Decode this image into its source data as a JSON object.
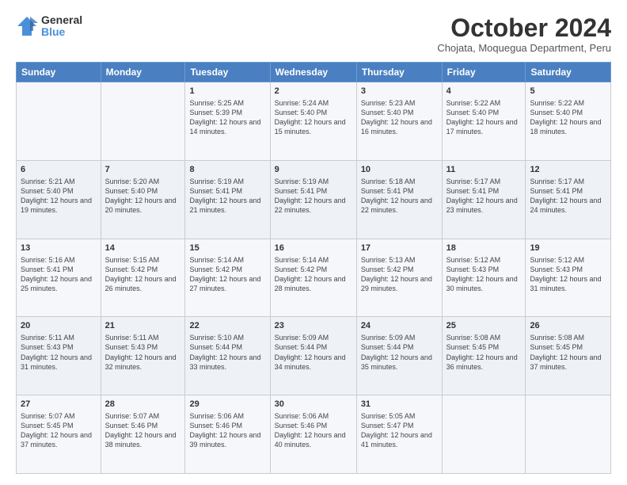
{
  "logo": {
    "general": "General",
    "blue": "Blue"
  },
  "header": {
    "month": "October 2024",
    "location": "Chojata, Moquegua Department, Peru"
  },
  "weekdays": [
    "Sunday",
    "Monday",
    "Tuesday",
    "Wednesday",
    "Thursday",
    "Friday",
    "Saturday"
  ],
  "weeks": [
    [
      {
        "day": "",
        "info": ""
      },
      {
        "day": "",
        "info": ""
      },
      {
        "day": "1",
        "info": "Sunrise: 5:25 AM\nSunset: 5:39 PM\nDaylight: 12 hours and 14 minutes."
      },
      {
        "day": "2",
        "info": "Sunrise: 5:24 AM\nSunset: 5:40 PM\nDaylight: 12 hours and 15 minutes."
      },
      {
        "day": "3",
        "info": "Sunrise: 5:23 AM\nSunset: 5:40 PM\nDaylight: 12 hours and 16 minutes."
      },
      {
        "day": "4",
        "info": "Sunrise: 5:22 AM\nSunset: 5:40 PM\nDaylight: 12 hours and 17 minutes."
      },
      {
        "day": "5",
        "info": "Sunrise: 5:22 AM\nSunset: 5:40 PM\nDaylight: 12 hours and 18 minutes."
      }
    ],
    [
      {
        "day": "6",
        "info": "Sunrise: 5:21 AM\nSunset: 5:40 PM\nDaylight: 12 hours and 19 minutes."
      },
      {
        "day": "7",
        "info": "Sunrise: 5:20 AM\nSunset: 5:40 PM\nDaylight: 12 hours and 20 minutes."
      },
      {
        "day": "8",
        "info": "Sunrise: 5:19 AM\nSunset: 5:41 PM\nDaylight: 12 hours and 21 minutes."
      },
      {
        "day": "9",
        "info": "Sunrise: 5:19 AM\nSunset: 5:41 PM\nDaylight: 12 hours and 22 minutes."
      },
      {
        "day": "10",
        "info": "Sunrise: 5:18 AM\nSunset: 5:41 PM\nDaylight: 12 hours and 22 minutes."
      },
      {
        "day": "11",
        "info": "Sunrise: 5:17 AM\nSunset: 5:41 PM\nDaylight: 12 hours and 23 minutes."
      },
      {
        "day": "12",
        "info": "Sunrise: 5:17 AM\nSunset: 5:41 PM\nDaylight: 12 hours and 24 minutes."
      }
    ],
    [
      {
        "day": "13",
        "info": "Sunrise: 5:16 AM\nSunset: 5:41 PM\nDaylight: 12 hours and 25 minutes."
      },
      {
        "day": "14",
        "info": "Sunrise: 5:15 AM\nSunset: 5:42 PM\nDaylight: 12 hours and 26 minutes."
      },
      {
        "day": "15",
        "info": "Sunrise: 5:14 AM\nSunset: 5:42 PM\nDaylight: 12 hours and 27 minutes."
      },
      {
        "day": "16",
        "info": "Sunrise: 5:14 AM\nSunset: 5:42 PM\nDaylight: 12 hours and 28 minutes."
      },
      {
        "day": "17",
        "info": "Sunrise: 5:13 AM\nSunset: 5:42 PM\nDaylight: 12 hours and 29 minutes."
      },
      {
        "day": "18",
        "info": "Sunrise: 5:12 AM\nSunset: 5:43 PM\nDaylight: 12 hours and 30 minutes."
      },
      {
        "day": "19",
        "info": "Sunrise: 5:12 AM\nSunset: 5:43 PM\nDaylight: 12 hours and 31 minutes."
      }
    ],
    [
      {
        "day": "20",
        "info": "Sunrise: 5:11 AM\nSunset: 5:43 PM\nDaylight: 12 hours and 31 minutes."
      },
      {
        "day": "21",
        "info": "Sunrise: 5:11 AM\nSunset: 5:43 PM\nDaylight: 12 hours and 32 minutes."
      },
      {
        "day": "22",
        "info": "Sunrise: 5:10 AM\nSunset: 5:44 PM\nDaylight: 12 hours and 33 minutes."
      },
      {
        "day": "23",
        "info": "Sunrise: 5:09 AM\nSunset: 5:44 PM\nDaylight: 12 hours and 34 minutes."
      },
      {
        "day": "24",
        "info": "Sunrise: 5:09 AM\nSunset: 5:44 PM\nDaylight: 12 hours and 35 minutes."
      },
      {
        "day": "25",
        "info": "Sunrise: 5:08 AM\nSunset: 5:45 PM\nDaylight: 12 hours and 36 minutes."
      },
      {
        "day": "26",
        "info": "Sunrise: 5:08 AM\nSunset: 5:45 PM\nDaylight: 12 hours and 37 minutes."
      }
    ],
    [
      {
        "day": "27",
        "info": "Sunrise: 5:07 AM\nSunset: 5:45 PM\nDaylight: 12 hours and 37 minutes."
      },
      {
        "day": "28",
        "info": "Sunrise: 5:07 AM\nSunset: 5:46 PM\nDaylight: 12 hours and 38 minutes."
      },
      {
        "day": "29",
        "info": "Sunrise: 5:06 AM\nSunset: 5:46 PM\nDaylight: 12 hours and 39 minutes."
      },
      {
        "day": "30",
        "info": "Sunrise: 5:06 AM\nSunset: 5:46 PM\nDaylight: 12 hours and 40 minutes."
      },
      {
        "day": "31",
        "info": "Sunrise: 5:05 AM\nSunset: 5:47 PM\nDaylight: 12 hours and 41 minutes."
      },
      {
        "day": "",
        "info": ""
      },
      {
        "day": "",
        "info": ""
      }
    ]
  ]
}
